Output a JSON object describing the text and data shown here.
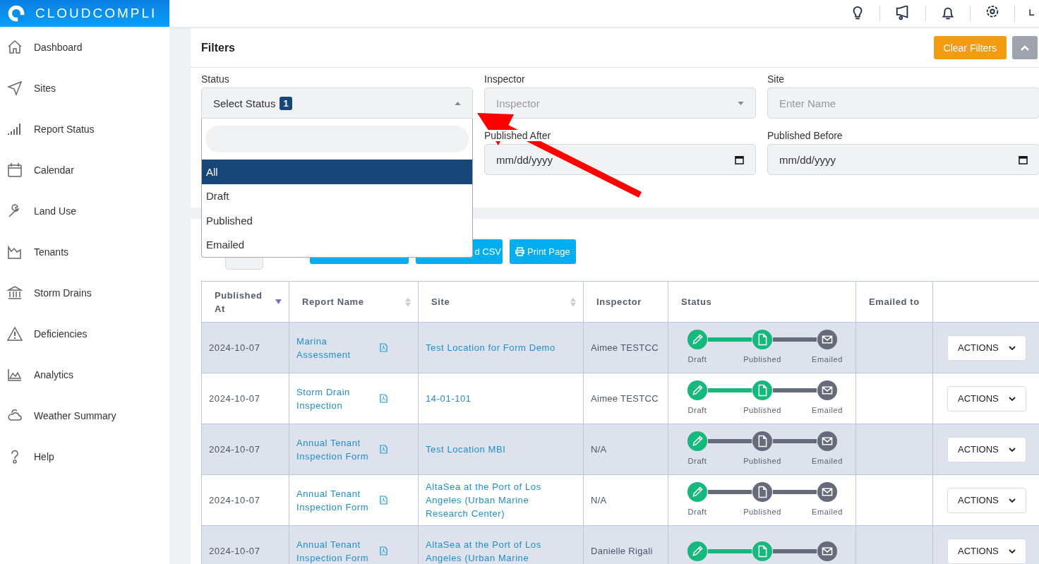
{
  "brand": {
    "name": "CLOUDCOMPLI"
  },
  "sidebar": {
    "items": [
      {
        "label": "Dashboard"
      },
      {
        "label": "Sites"
      },
      {
        "label": "Report Status"
      },
      {
        "label": "Calendar"
      },
      {
        "label": "Land Use"
      },
      {
        "label": "Tenants"
      },
      {
        "label": "Storm Drains"
      },
      {
        "label": "Deficiencies"
      },
      {
        "label": "Analytics"
      },
      {
        "label": "Weather Summary"
      },
      {
        "label": "Help"
      }
    ]
  },
  "filters": {
    "title": "Filters",
    "clear_button": "Clear Filters",
    "collapsed": false,
    "fields": [
      {
        "kind": "select",
        "label": "Status",
        "value": "Select Status",
        "badge": "1",
        "expanded": true,
        "options": [
          {
            "label": "All",
            "selected": true
          },
          {
            "label": "Draft",
            "selected": false
          },
          {
            "label": "Published",
            "selected": false
          },
          {
            "label": "Emailed",
            "selected": false
          }
        ]
      },
      {
        "kind": "select",
        "label": "Inspector",
        "placeholder": "Inspector",
        "expanded": false
      },
      {
        "kind": "text",
        "label": "Site",
        "placeholder": "Enter Name"
      },
      {
        "kind": "date",
        "label": "Published After",
        "value": "mm/dd/yyyy"
      },
      {
        "kind": "date",
        "label": "Published Before",
        "value": "mm/dd/yyyy"
      }
    ]
  },
  "toolbar": {
    "buttons": [
      {
        "kind": "blank"
      },
      {
        "kind": "csv",
        "label": "d CSV"
      },
      {
        "kind": "print",
        "label": "Print Page"
      }
    ]
  },
  "table": {
    "columns": [
      {
        "label": "Published At",
        "sortable": true,
        "sorted": true
      },
      {
        "label": "Report Name",
        "sortable": true,
        "sorted": false
      },
      {
        "label": "Site",
        "sortable": true,
        "sorted": false
      },
      {
        "label": "Inspector"
      },
      {
        "label": "Status"
      },
      {
        "label": "Emailed to"
      }
    ],
    "rows": [
      {
        "published_at": "2024-10-07",
        "report_name": "Marina Assessment",
        "site": "Test Location for Form Demo",
        "inspector": "Aimee TESTCC",
        "steps": [
          {
            "label": "Draft",
            "done": true
          },
          {
            "label": "Published",
            "done": true
          },
          {
            "label": "Emailed",
            "done": false
          }
        ],
        "action": "ACTIONS"
      },
      {
        "published_at": "2024-10-07",
        "report_name": "Storm Drain Inspection",
        "site": "14-01-101",
        "inspector": "Aimee TESTCC",
        "steps": [
          {
            "label": "Draft",
            "done": true
          },
          {
            "label": "Published",
            "done": true
          },
          {
            "label": "Emailed",
            "done": false
          }
        ],
        "action": "ACTIONS"
      },
      {
        "published_at": "2024-10-07",
        "report_name": "Annual Tenant Inspection Form",
        "site": "Test Location MBI",
        "inspector": "N/A",
        "steps": [
          {
            "label": "Draft",
            "done": true
          },
          {
            "label": "Published",
            "done": false
          },
          {
            "label": "Emailed",
            "done": false
          }
        ],
        "action": "ACTIONS"
      },
      {
        "published_at": "2024-10-07",
        "report_name": "Annual Tenant Inspection Form",
        "site": "AltaSea at the Port of Los Angeles (Urban Marine Research Center)",
        "inspector": "N/A",
        "steps": [
          {
            "label": "Draft",
            "done": true
          },
          {
            "label": "Published",
            "done": false
          },
          {
            "label": "Emailed",
            "done": false
          }
        ],
        "action": "ACTIONS"
      },
      {
        "published_at": "2024-10-07",
        "report_name": "Annual Tenant Inspection Form",
        "site": "AltaSea at the Port of Los Angeles (Urban Marine",
        "inspector": "Danielle Rigali",
        "steps": [
          {
            "done": true
          },
          {
            "done": true
          },
          {
            "done": false
          }
        ],
        "action": "ACTIONS"
      }
    ]
  }
}
